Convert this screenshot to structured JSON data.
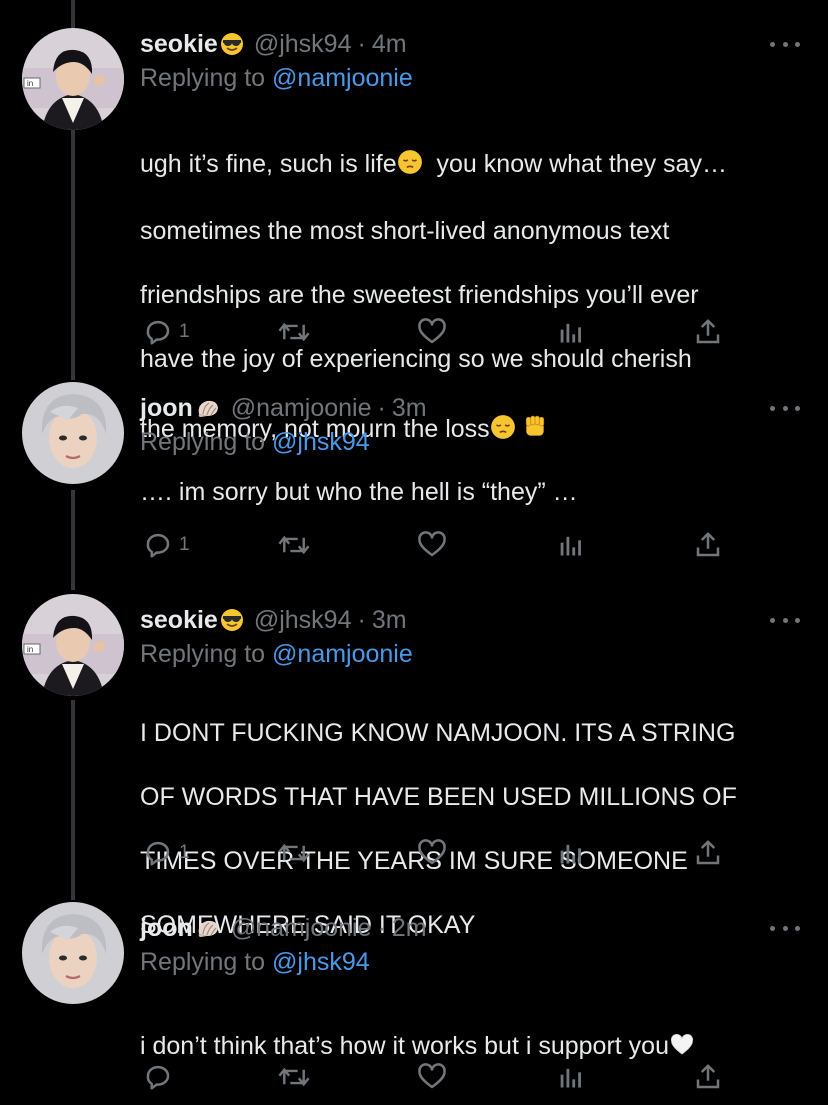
{
  "tweets": [
    {
      "display_name": "seokie",
      "name_emoji": "sunglasses-face",
      "handle": "@jhsk94",
      "separator": "·",
      "time": "4m",
      "reply_prefix": "Replying to",
      "reply_to": "@namjoonie",
      "text_lines": [
        "ugh it’s fine, such is life",
        "you know what they say…",
        "sometimes the most short-lived anonymous text",
        "friendships are the sweetest friendships you’ll ever",
        "have the joy of experiencing so we should cherish",
        "the memory, not mourn the loss"
      ],
      "reply_count": "1",
      "avatar": "avatar-seokie"
    },
    {
      "display_name": "joon",
      "name_emoji": "shell-emoji",
      "handle": "@namjoonie",
      "separator": "·",
      "time": "3m",
      "reply_prefix": "Replying to",
      "reply_to": "@jhsk94",
      "text": "…. im sorry but who the hell is “they” …",
      "reply_count": "1",
      "avatar": "avatar-joon"
    },
    {
      "display_name": "seokie",
      "name_emoji": "sunglasses-face",
      "handle": "@jhsk94",
      "separator": "·",
      "time": "3m",
      "reply_prefix": "Replying to",
      "reply_to": "@namjoonie",
      "text_lines": [
        "I DONT FUCKING KNOW NAMJOON. ITS A STRING",
        "OF WORDS THAT HAVE BEEN USED MILLIONS OF",
        "TIMES OVER THE YEARS IM SURE SOMEONE",
        "SOMEWHERE SAID IT OKAY"
      ],
      "reply_count": "1",
      "avatar": "avatar-seokie"
    },
    {
      "display_name": "joon",
      "name_emoji": "shell-emoji",
      "handle": "@namjoonie",
      "separator": "·",
      "time": "2m",
      "reply_prefix": "Replying to",
      "reply_to": "@jhsk94",
      "text": "i don’t think that’s how it works but i support you",
      "reply_count": "",
      "avatar": "avatar-joon"
    }
  ],
  "icons": {
    "reply": "reply-icon",
    "retweet": "retweet-icon",
    "like": "heart-icon",
    "views": "views-icon",
    "share": "share-icon",
    "more": "more-icon"
  },
  "colors": {
    "background": "#000000",
    "text": "#e7e9ea",
    "muted": "#71767b",
    "link": "#4a99e9",
    "thread_line": "#333639"
  }
}
